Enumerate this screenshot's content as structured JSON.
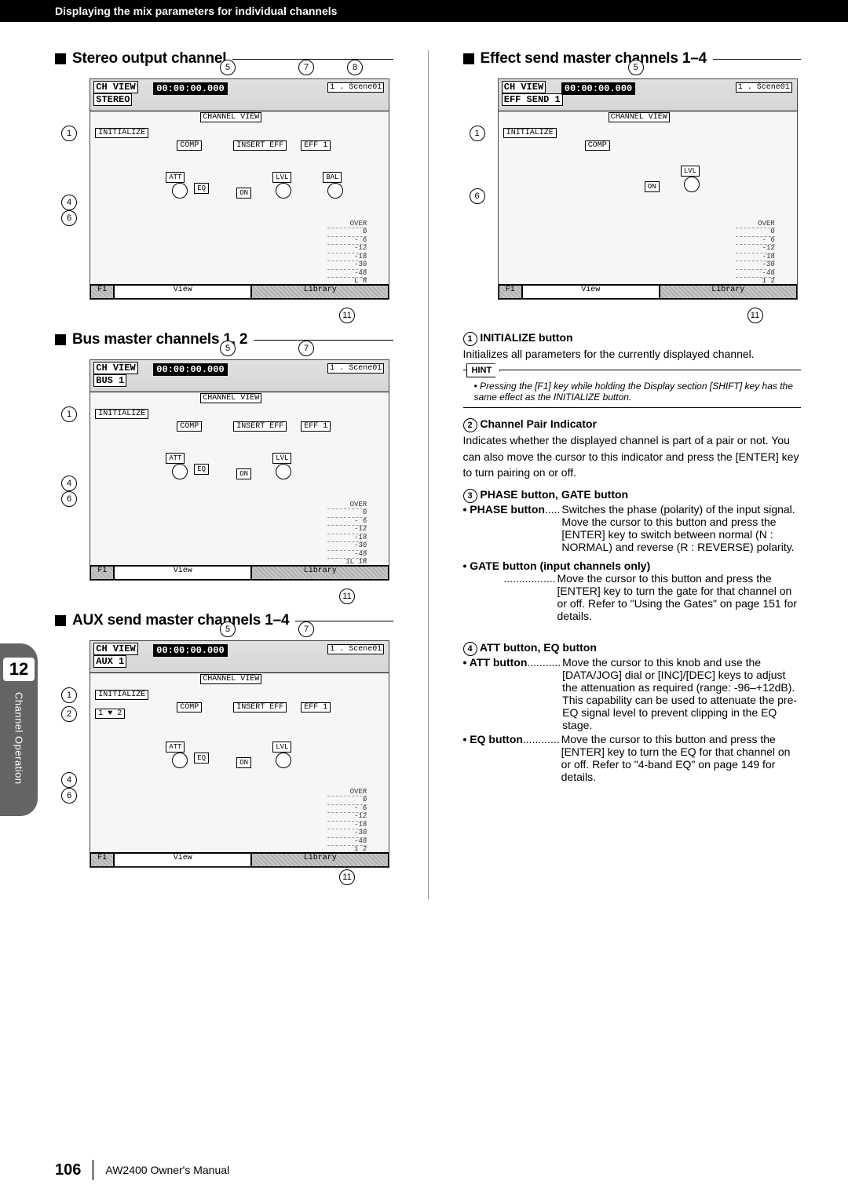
{
  "header": {
    "breadcrumb": "Displaying the mix parameters for individual channels"
  },
  "side_tab": {
    "number": "12",
    "label": "Channel Operation"
  },
  "left": {
    "sec1": {
      "title": "Stereo output channel"
    },
    "sec2": {
      "title": "Bus master channels 1, 2"
    },
    "sec3": {
      "title": "AUX send master channels 1–4"
    }
  },
  "right": {
    "sec": {
      "title": "Effect send master channels 1–4"
    },
    "item1": {
      "num": "1",
      "head": "INITIALIZE button",
      "body": "Initializes all parameters for the currently displayed channel."
    },
    "hint": {
      "tag": "HINT",
      "body": "Pressing the [F1] key while holding the Display section [SHIFT] key has the same effect as the INITIALIZE button."
    },
    "item2": {
      "num": "2",
      "head": "Channel Pair Indicator",
      "body": "Indicates whether the displayed channel is part of a pair or not. You can also move the cursor to this indicator and press the [ENTER] key to turn pairing on or off."
    },
    "item3": {
      "num": "3",
      "head": "PHASE button, GATE button",
      "phase_label": "• PHASE button",
      "phase_dots": ".....",
      "phase_val": "Switches the phase (polarity) of the input signal. Move the cursor to this button and press the [ENTER] key to switch between normal (N : NORMAL) and reverse (R : REVERSE) polarity.",
      "gate_label": "• GATE button (input channels only)",
      "gate_dots": ".................",
      "gate_val": "Move the cursor to this button and press the [ENTER] key to turn the gate for that channel on or off. Refer to \"Using the Gates\" on page 151 for details."
    },
    "item4": {
      "num": "4",
      "head": "ATT button, EQ button",
      "att_label": "• ATT button",
      "att_dots": "...........",
      "att_val": "Move the cursor to this knob and use the [DATA/JOG] dial or [INC]/[DEC] keys to adjust the attenuation as required (range: -96–+12dB). This capability can be used to attenuate the pre-EQ signal level to prevent clipping in the EQ stage.",
      "eq_label": "• EQ button",
      "eq_dots": "............",
      "eq_val": "Move the cursor to this button and press the [ENTER] key to turn the EQ for that channel on or off. Refer to \"4-band EQ\" on page 149 for details."
    }
  },
  "lcd_common": {
    "ch_view": "CH VIEW",
    "time": "00:00:00.000",
    "scene": "1 . Scene01",
    "channel_view": "CHANNEL VIEW",
    "initialize": "INITIALIZE",
    "comp": "COMP",
    "insert_eff": "INSERT EFF",
    "eff1": "EFF 1",
    "att": "ATT",
    "eq": "EQ",
    "on": "ON",
    "lvl": "LVL",
    "bal": "BAL",
    "view_tab": "View",
    "library_tab": "Library",
    "over": "OVER",
    "m0": "0",
    "m6": "- 6",
    "m12": "-12",
    "m18": "-18",
    "m30": "-30",
    "m48": "-48"
  },
  "lcd": {
    "stereo_sub": "STEREO",
    "bus_sub": "BUS 1",
    "aux_sub": "AUX 1",
    "eff_sub": "EFF SEND 1",
    "lr": "L  R",
    "ilir": "1L 1R",
    "p12": "1   2"
  },
  "callouts": {
    "c1": "1",
    "c2": "2",
    "c4": "4",
    "c5": "5",
    "c6": "6",
    "c7": "7",
    "c8": "8",
    "c11": "11"
  },
  "footer": {
    "page": "106",
    "book": "AW2400  Owner's Manual"
  }
}
